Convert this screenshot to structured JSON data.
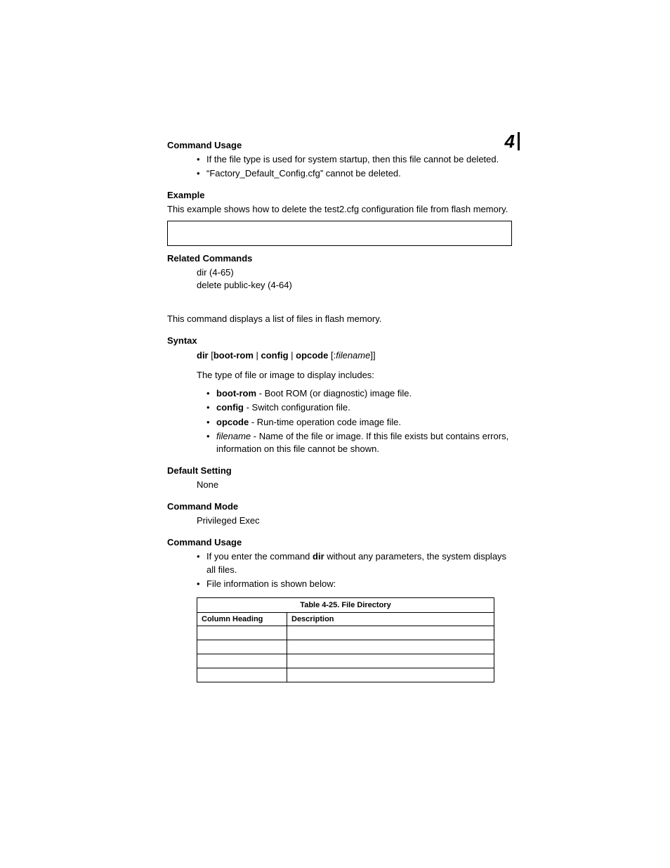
{
  "chapter": "4",
  "sections": {
    "command_usage_1": {
      "heading": "Command Usage",
      "bullets": [
        "If the file type is used for system startup, then this file cannot be deleted.",
        "“Factory_Default_Config.cfg” cannot be deleted."
      ]
    },
    "example": {
      "heading": "Example",
      "text": "This example shows how to delete the test2.cfg configuration file from flash memory."
    },
    "related_commands": {
      "heading": "Related Commands",
      "lines": [
        "dir (4-65)",
        "delete public-key (4-64)"
      ]
    },
    "command_description": "This command displays a list of files in flash memory.",
    "syntax": {
      "heading": "Syntax",
      "cmd_parts": {
        "p1": "dir",
        "b1": " [",
        "p2": "boot-rom",
        "s1": " | ",
        "p3": "config",
        "s2": " | ",
        "p4": "opcode",
        "b2": " [:",
        "p5": "filename",
        "b3": "]]"
      },
      "type_intro": "The type of file or image to display includes:",
      "options": [
        {
          "name": "boot-rom",
          "desc": " - Boot ROM (or diagnostic) image file."
        },
        {
          "name": "config",
          "desc": " - Switch configuration file."
        },
        {
          "name": "opcode",
          "desc": " - Run-time operation code image file."
        },
        {
          "name_italic": "filename",
          "desc": " - Name of the file or image. If this file exists but contains errors, information on this file cannot be shown."
        }
      ]
    },
    "default_setting": {
      "heading": "Default Setting",
      "value": "None"
    },
    "command_mode": {
      "heading": "Command Mode",
      "value": "Privileged Exec"
    },
    "command_usage_2": {
      "heading": "Command Usage",
      "bullet1_pre": "If you enter the command ",
      "bullet1_bold": "dir",
      "bullet1_post": " without any parameters, the system displays all files.",
      "bullet2": "File information is shown below:"
    },
    "table": {
      "title": "Table 4-25.  File Directory",
      "headers": [
        "Column Heading",
        "Description"
      ],
      "rows": [
        [
          "",
          ""
        ],
        [
          "",
          ""
        ],
        [
          "",
          ""
        ],
        [
          "",
          ""
        ]
      ]
    }
  }
}
